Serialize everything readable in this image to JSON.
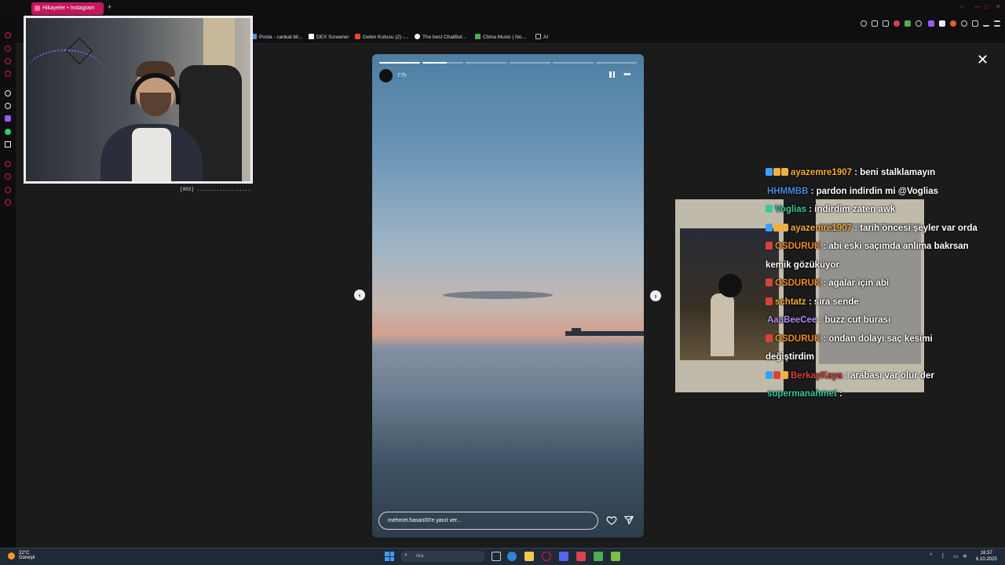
{
  "browser": {
    "tab_title": "Hikayeler • Instagram",
    "new_tab": "+",
    "bookmarks": [
      {
        "label": "Posta - cankat bil...",
        "color": "#4a90e2"
      },
      {
        "label": "DEX Screener",
        "color": "#ffffff"
      },
      {
        "label": "Gelen Kutusu (2) -...",
        "color": "#ea4335"
      },
      {
        "label": "The best ChatBot...",
        "color": "#ffffff"
      },
      {
        "label": "China Music | No...",
        "color": "#4caf50"
      },
      {
        "label": "AI",
        "color": "#bbbbbb"
      }
    ]
  },
  "webcam": {
    "caption": "[003] ..................."
  },
  "story": {
    "time": "77h",
    "progress": {
      "segments": 6,
      "completed": 1,
      "current_fraction": 0.6
    },
    "reply_placeholder": "mehmet.hasan00'e yanıt ver..."
  },
  "chat": [
    {
      "user": "ayazemre1907",
      "color": "#f2b03c",
      "text": ": beni stalklamayın",
      "badges": [
        "#3aa0ff",
        "#f2b03c",
        "#f2b03c"
      ]
    },
    {
      "user": "HHMMBB",
      "color": "#4a8bd6",
      "text": ": pardon indirdin mi @Voglias",
      "badges": []
    },
    {
      "user": "Voglias",
      "color": "#37c8a0",
      "text": ": indirdim zaten awk",
      "badges": [
        "#37c8a0"
      ]
    },
    {
      "user": "ayazemre1907",
      "color": "#f2b03c",
      "text": ": tarih öncesi şeyler var orda",
      "badges": [
        "#3aa0ff",
        "#f2b03c",
        "#f2b03c"
      ]
    },
    {
      "user": "OSDURUK",
      "color": "#f28c28",
      "text": ": abi eski saçımda anlıma bakrsan kemik gözüküyor",
      "badges": [
        "#d9413a"
      ]
    },
    {
      "user": "OSDURUK",
      "color": "#f28c28",
      "text": ": agalar için abi",
      "badges": [
        "#d9413a"
      ]
    },
    {
      "user": "schtatz",
      "color": "#f2b03c",
      "text": ": sıra sende",
      "badges": [
        "#d9413a"
      ]
    },
    {
      "user": "AaaBeeCee",
      "color": "#b58cf2",
      "text": ": buzz cut burası",
      "badges": []
    },
    {
      "user": "OSDURUK",
      "color": "#f28c28",
      "text": ": ondan dolayı saç kesimi değiştirdim",
      "badges": [
        "#d9413a"
      ]
    },
    {
      "user": "BerkayKaya",
      "color": "#d9413a",
      "text": ": arabası var olur der",
      "badges": [
        "#3aa0ff",
        "#d9413a",
        "#f2b03c"
      ]
    },
    {
      "user": "supermanahmet",
      "color": "#37c8a0",
      "text": ":",
      "badges": []
    }
  ],
  "taskbar": {
    "temperature": "22°C",
    "weather": "Güneşli",
    "search_placeholder": "Ara",
    "time": "16:37",
    "date": "6.10.2025"
  }
}
